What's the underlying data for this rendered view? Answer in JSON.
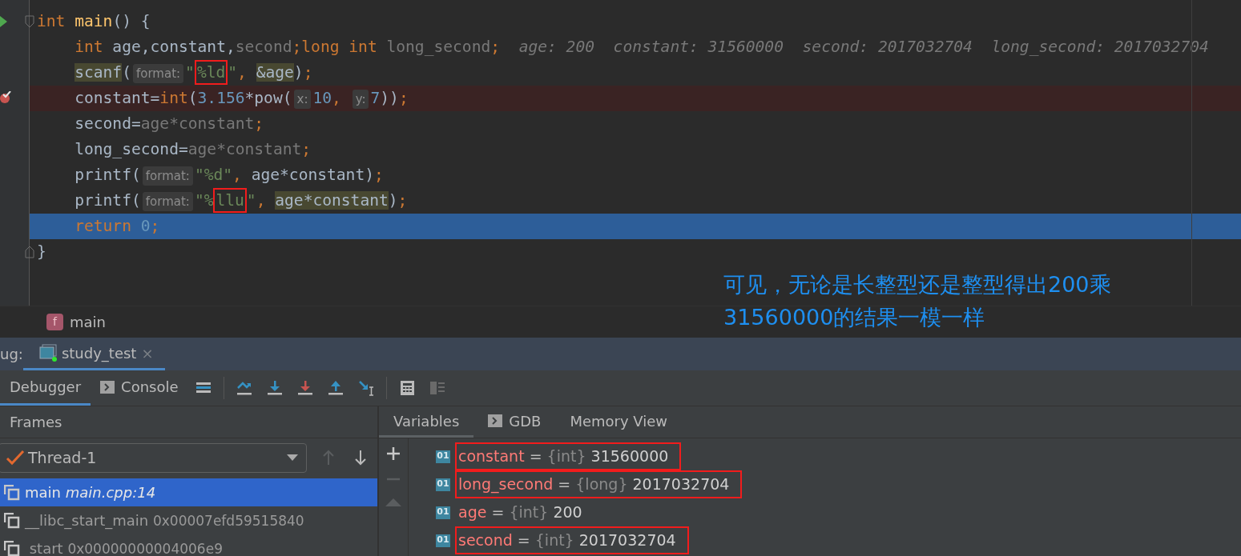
{
  "editor": {
    "lines": [
      {
        "kind": "normal",
        "indented": false,
        "runnable": true,
        "breakpoint": false,
        "fold": true,
        "tokens": [
          {
            "text": "int",
            "kind": "keyword"
          },
          {
            "text": " main",
            "kind": "function"
          },
          {
            "text": "() {",
            "kind": "plain"
          }
        ]
      },
      {
        "kind": "normal",
        "indented": true,
        "runnable": false,
        "breakpoint": false,
        "fold": false,
        "tokens": [
          {
            "text": "int",
            "kind": "keyword"
          },
          {
            "text": " age,constant,",
            "kind": "plain"
          },
          {
            "text": "second",
            "kind": "unused"
          },
          {
            "text": ";",
            "kind": "keyword"
          },
          {
            "text": "long int",
            "kind": "keyword"
          },
          {
            "text": " long_second",
            "kind": "unused"
          },
          {
            "text": ";",
            "kind": "keyword"
          }
        ],
        "inline_values": "age: 200  constant: 31560000  second: 2017032704  long_second: 2017032704"
      },
      {
        "kind": "normal",
        "indented": true,
        "runnable": false,
        "breakpoint": false,
        "fold": false,
        "tokens": [
          {
            "text": "scanf",
            "kind": "usage"
          },
          {
            "text": "(",
            "kind": "plain"
          },
          {
            "text": "format:",
            "kind": "hint"
          },
          {
            "text": "\"",
            "kind": "string"
          },
          {
            "text": "%ld",
            "kind": "boxed"
          },
          {
            "text": "\"",
            "kind": "string"
          },
          {
            "text": ", ",
            "kind": "keyword"
          },
          {
            "text": "&age",
            "kind": "usage"
          },
          {
            "text": ")",
            "kind": "plain"
          },
          {
            "text": ";",
            "kind": "keyword"
          }
        ]
      },
      {
        "kind": "breakpoint",
        "indented": true,
        "runnable": false,
        "breakpoint": true,
        "fold": false,
        "tokens": [
          {
            "text": "constant=",
            "kind": "plain"
          },
          {
            "text": "int",
            "kind": "keyword"
          },
          {
            "text": "(",
            "kind": "plain"
          },
          {
            "text": "3.156",
            "kind": "number"
          },
          {
            "text": "*pow(",
            "kind": "plain"
          },
          {
            "text": "x:",
            "kind": "hint"
          },
          {
            "text": "10",
            "kind": "number"
          },
          {
            "text": ", ",
            "kind": "keyword"
          },
          {
            "text": "y:",
            "kind": "hint"
          },
          {
            "text": "7",
            "kind": "number"
          },
          {
            "text": "))",
            "kind": "plain"
          },
          {
            "text": ";",
            "kind": "keyword"
          }
        ]
      },
      {
        "kind": "normal",
        "indented": true,
        "runnable": false,
        "breakpoint": false,
        "fold": false,
        "tokens": [
          {
            "text": "second=",
            "kind": "plain"
          },
          {
            "text": "age*constant",
            "kind": "unused"
          },
          {
            "text": ";",
            "kind": "keyword"
          }
        ]
      },
      {
        "kind": "normal",
        "indented": true,
        "runnable": false,
        "breakpoint": false,
        "fold": false,
        "tokens": [
          {
            "text": "long_second=",
            "kind": "plain"
          },
          {
            "text": "age*constant",
            "kind": "unused"
          },
          {
            "text": ";",
            "kind": "keyword"
          }
        ]
      },
      {
        "kind": "normal",
        "indented": true,
        "runnable": false,
        "breakpoint": false,
        "fold": false,
        "tokens": [
          {
            "text": "printf(",
            "kind": "plain"
          },
          {
            "text": "format:",
            "kind": "hint"
          },
          {
            "text": "\"%d\"",
            "kind": "string"
          },
          {
            "text": ", ",
            "kind": "keyword"
          },
          {
            "text": "age*constant",
            "kind": "plain"
          },
          {
            "text": ")",
            "kind": "plain"
          },
          {
            "text": ";",
            "kind": "keyword"
          }
        ]
      },
      {
        "kind": "normal",
        "indented": true,
        "runnable": false,
        "breakpoint": false,
        "fold": false,
        "tokens": [
          {
            "text": "printf(",
            "kind": "plain"
          },
          {
            "text": "format:",
            "kind": "hint"
          },
          {
            "text": "\"%",
            "kind": "string"
          },
          {
            "text": "llu",
            "kind": "boxed"
          },
          {
            "text": "\"",
            "kind": "string"
          },
          {
            "text": ", ",
            "kind": "keyword"
          },
          {
            "text": "age*constant",
            "kind": "usage"
          },
          {
            "text": ")",
            "kind": "plain"
          },
          {
            "text": ";",
            "kind": "keyword"
          }
        ]
      },
      {
        "kind": "execution",
        "indented": true,
        "runnable": false,
        "breakpoint": false,
        "fold": false,
        "tokens": [
          {
            "text": "return",
            "kind": "keyword"
          },
          {
            "text": " 0",
            "kind": "number"
          },
          {
            "text": ";",
            "kind": "keyword"
          }
        ]
      },
      {
        "kind": "normal",
        "indented": false,
        "runnable": false,
        "breakpoint": false,
        "fold": true,
        "tokens": [
          {
            "text": "}",
            "kind": "plain"
          }
        ]
      }
    ]
  },
  "annotation": {
    "lines": [
      "可见，无论是长整型还是整型得出200乘",
      "31560000的结果一模一样"
    ]
  },
  "breadcrumb": {
    "icon_letter": "f",
    "label": "main"
  },
  "debug_bar": {
    "label": "ug:",
    "session": {
      "label": "study_test",
      "close": "×",
      "selected": true
    }
  },
  "toolbar_tabs": [
    {
      "label": "Debugger",
      "kind": "plain",
      "selected": true
    },
    {
      "label": "Console",
      "kind": "console",
      "selected": false
    }
  ],
  "frames": {
    "title": "Frames",
    "thread": "Thread-1",
    "items": [
      {
        "name": "main",
        "location": "main.cpp:14",
        "kind": "source",
        "selected": true
      },
      {
        "name": "__libc_start_main",
        "location": "0x00007efd59515840",
        "kind": "address",
        "selected": false
      },
      {
        "name": " start",
        "location": "0x00000000004006e9",
        "kind": "address",
        "selected": false
      }
    ]
  },
  "variables_tabs": [
    {
      "label": "Variables",
      "kind": "plain",
      "selected": true
    },
    {
      "label": "GDB",
      "kind": "console",
      "selected": false
    },
    {
      "label": "Memory View",
      "kind": "plain",
      "selected": false
    }
  ],
  "variables": [
    {
      "badge": "01",
      "name": "constant",
      "separator": "=",
      "type": "{int}",
      "value": "31560000",
      "boxed": true
    },
    {
      "badge": "01",
      "name": "long_second",
      "separator": "=",
      "type": "{long}",
      "value": "2017032704",
      "boxed": true
    },
    {
      "badge": "01",
      "name": "age",
      "separator": "=",
      "type": "{int}",
      "value": "200",
      "boxed": false
    },
    {
      "badge": "01",
      "name": "second",
      "separator": "=",
      "type": "{int}",
      "value": "2017032704",
      "boxed": true
    }
  ]
}
